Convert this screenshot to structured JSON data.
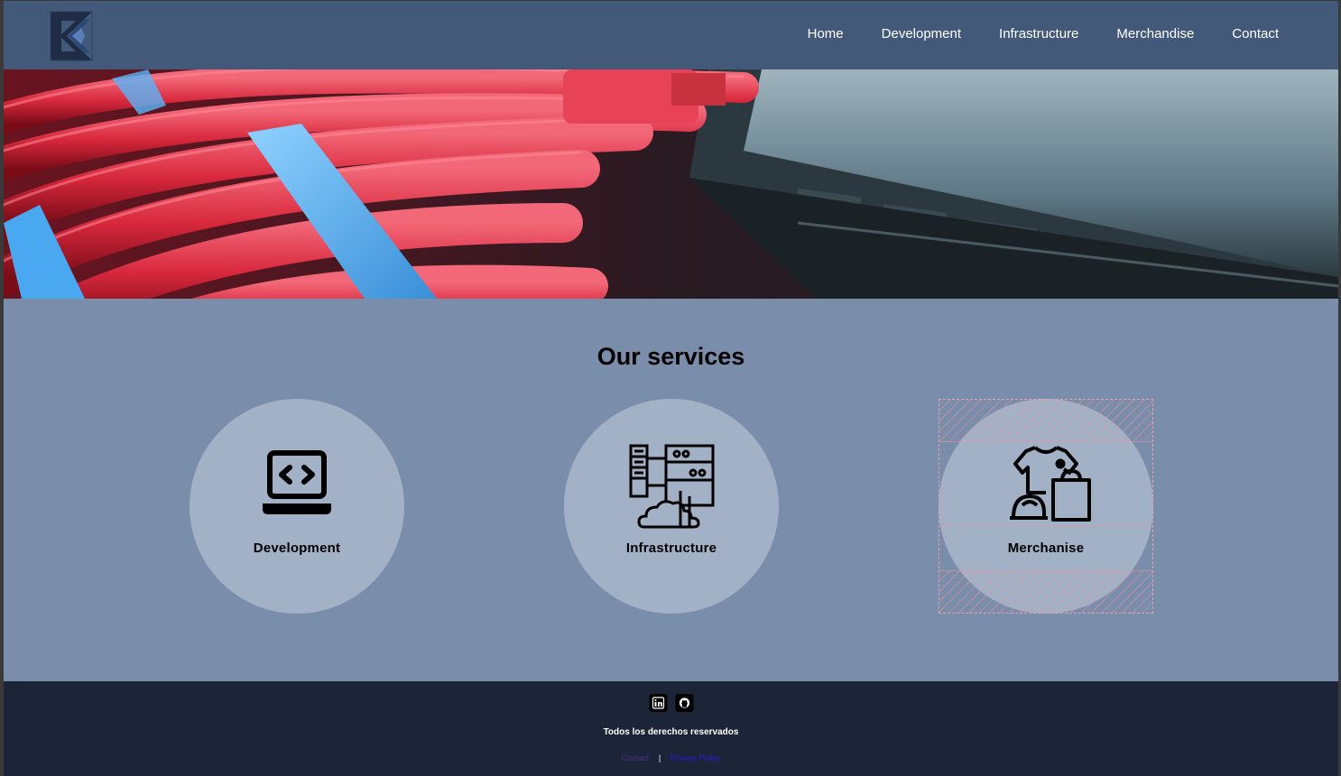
{
  "header": {
    "logo_icon": "ek-logo-icon",
    "nav": [
      {
        "label": "Home"
      },
      {
        "label": "Development"
      },
      {
        "label": "Infrastructure"
      },
      {
        "label": "Merchandise"
      },
      {
        "label": "Contact"
      }
    ]
  },
  "hero": {
    "image": "network-cables-switch-photo"
  },
  "services": {
    "title": "Our services",
    "cards": [
      {
        "label": "Development",
        "icon": "laptop-code-icon"
      },
      {
        "label": "Infrastructure",
        "icon": "server-cloud-icon"
      },
      {
        "label": "Merchanise",
        "icon": "tshirt-cap-bag-icon"
      }
    ]
  },
  "footer": {
    "social": [
      {
        "icon": "linkedin-icon"
      },
      {
        "icon": "github-icon"
      }
    ],
    "rights": "Todos los derechos reservados",
    "contact_link": "Contact",
    "separator": "|",
    "privacy_link": "Privacy Policy"
  },
  "colors": {
    "header_bg": "#43597a",
    "body_bg": "#7a8daa",
    "card_bg": "#a3b1c7",
    "footer_bg": "#1c2438",
    "contact_link": "#4f2e8c",
    "privacy_link": "#2020d8"
  }
}
